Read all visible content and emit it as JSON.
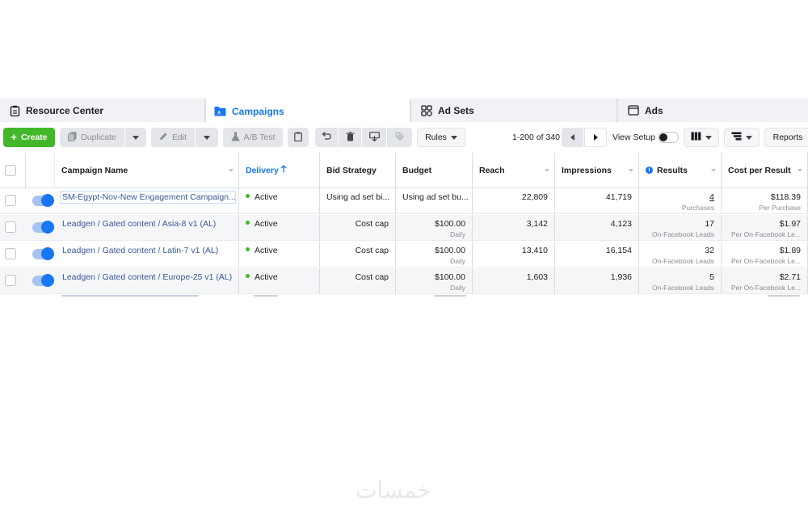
{
  "tabs": [
    {
      "label": "Resource Center",
      "icon": "clipboard-icon"
    },
    {
      "label": "Campaigns",
      "icon": "folder-icon",
      "active": true
    },
    {
      "label": "Ad Sets",
      "icon": "grid-icon"
    },
    {
      "label": "Ads",
      "icon": "window-icon"
    }
  ],
  "toolbar": {
    "create": "Create",
    "duplicate": "Duplicate",
    "edit": "Edit",
    "ab_test": "A/B Test",
    "rules": "Rules",
    "pager": "1-200 of 340",
    "view_setup": "View Setup",
    "reports": "Reports"
  },
  "columns": {
    "campaign_name": "Campaign Name",
    "delivery": "Delivery",
    "bid_strategy": "Bid Strategy",
    "budget": "Budget",
    "reach": "Reach",
    "impressions": "Impressions",
    "results": "Results",
    "cost_per_result": "Cost per Result"
  },
  "rows": [
    {
      "name": "SM-Egypt-Nov-New Engagement Campaign...",
      "delivery": "Active",
      "bid": "Using ad set bi...",
      "budget": "Using ad set bu...",
      "budget_sub": "",
      "reach": "22,809",
      "impressions": "41,719",
      "results": "4",
      "results_sub": "Purchases",
      "cost": "$118.39",
      "cost_sub": "Per Purchase"
    },
    {
      "name": "Leadgen / Gated content / Asia-8 v1 (AL)",
      "delivery": "Active",
      "bid": "Cost cap",
      "budget": "$100.00",
      "budget_sub": "Daily",
      "reach": "3,142",
      "impressions": "4,123",
      "results": "17",
      "results_sub": "On-Facebook Leads",
      "cost": "$1.97",
      "cost_sub": "Per On-Facebook Le..."
    },
    {
      "name": "Leadgen / Gated content / Latin-7 v1 (AL)",
      "delivery": "Active",
      "bid": "Cost cap",
      "budget": "$100.00",
      "budget_sub": "Daily",
      "reach": "13,410",
      "impressions": "16,154",
      "results": "32",
      "results_sub": "On-Facebook Leads",
      "cost": "$1.89",
      "cost_sub": "Per On-Facebook Le..."
    },
    {
      "name": "Leadgen / Gated content / Europe-25 v1 (AL)",
      "delivery": "Active",
      "bid": "Cost cap",
      "budget": "$100.00",
      "budget_sub": "Daily",
      "reach": "1,603",
      "impressions": "1,936",
      "results": "5",
      "results_sub": "On-Facebook Leads",
      "cost": "$2.71",
      "cost_sub": "Per On-Facebook Le..."
    }
  ],
  "watermark": "خمسات"
}
